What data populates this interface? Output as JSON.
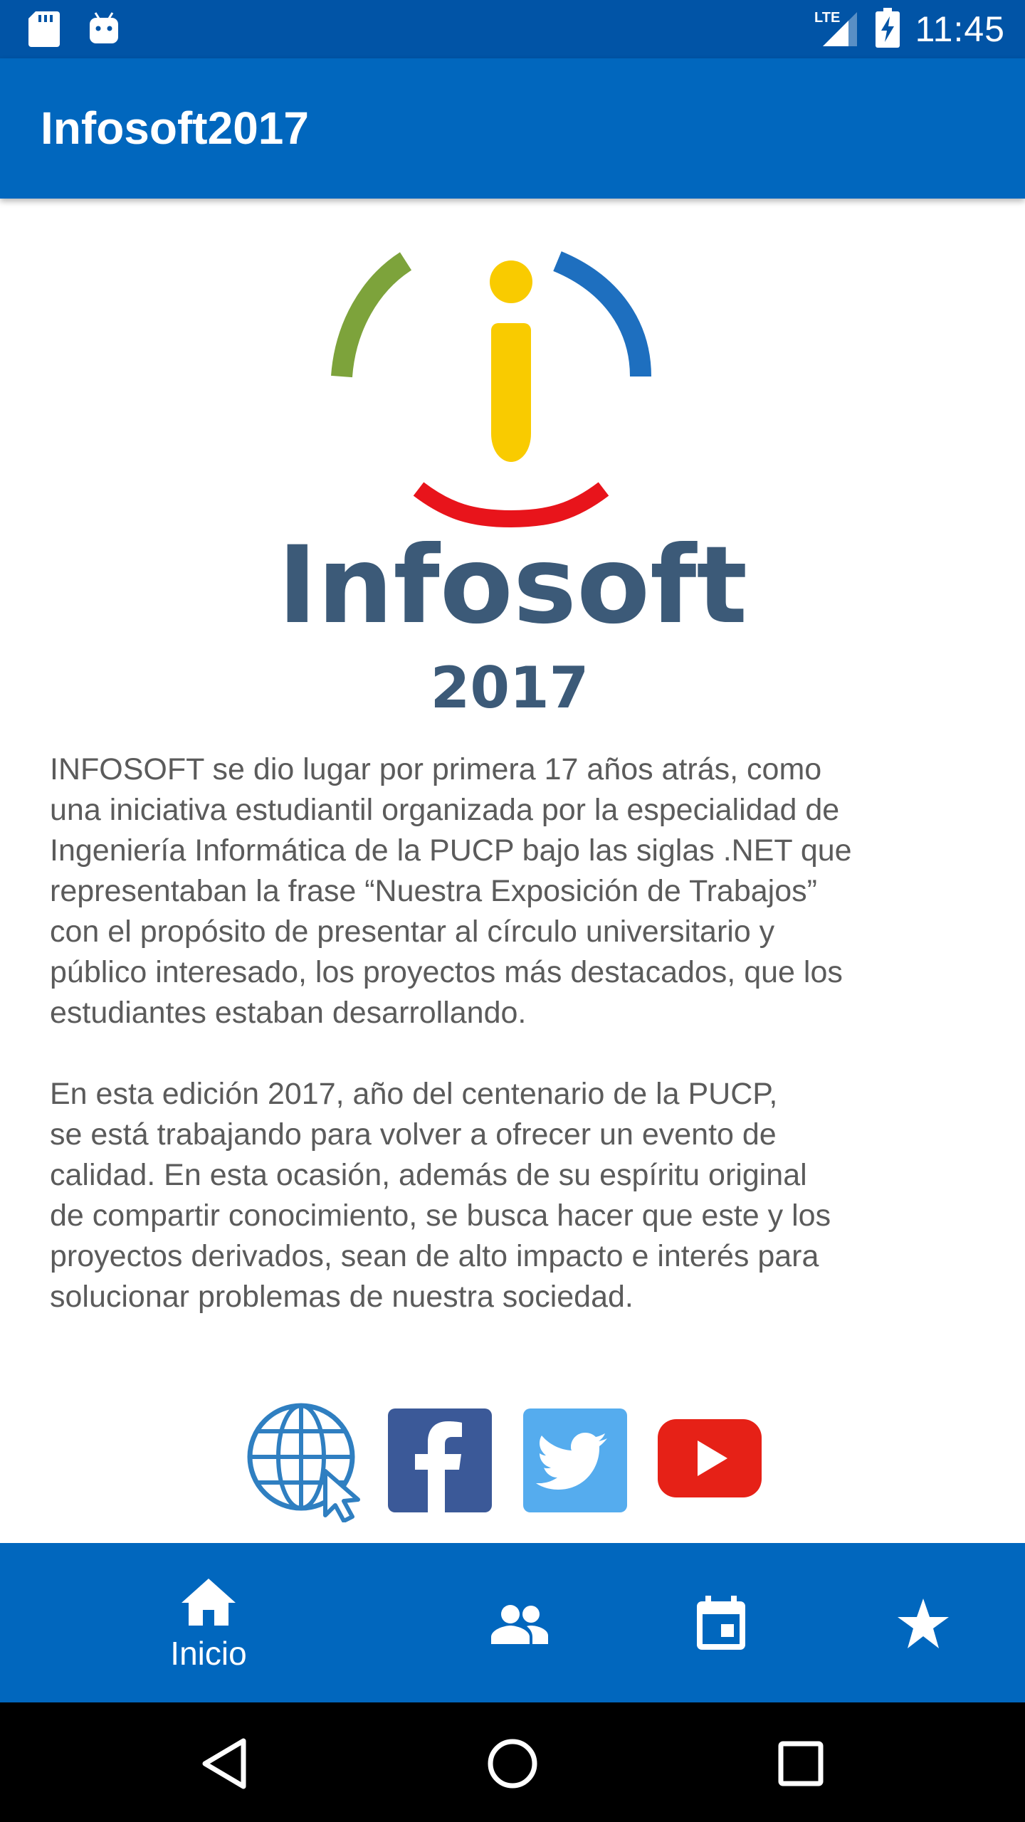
{
  "status_bar": {
    "time": "11:45",
    "network": "LTE",
    "icons": [
      "sd-card-icon",
      "android-icon",
      "lte-signal-icon",
      "battery-charging-icon"
    ]
  },
  "app_bar": {
    "title": "Infosoft2017"
  },
  "logo": {
    "wordmark": "Infosoft",
    "year": "2017",
    "colors": {
      "green": "#7DA33B",
      "blue": "#1E6FBF",
      "yellow": "#F9CB00",
      "red": "#E8141B",
      "text": "#3C5A78"
    }
  },
  "content": {
    "paragraph_1": "INFOSOFT se dio lugar por primera 17 años atrás, como\nuna iniciativa estudiantil organizada por la especialidad de\nIngeniería Informática de la PUCP bajo las siglas .NET que\nrepresentaban la frase “Nuestra Exposición de Trabajos”\ncon el propósito de presentar al círculo universitario y\npúblico interesado, los proyectos más destacados, que los\nestudiantes estaban desarrollando.",
    "paragraph_2": "En esta edición 2017, año del centenario de la PUCP,\nse está trabajando para volver a ofrecer un evento de\ncalidad. En esta ocasión, además de su espíritu original\nde compartir conocimiento, se busca hacer que este y los\nproyectos derivados, sean de alto impacto e interés para\nsolucionar problemas de nuestra sociedad."
  },
  "social_links": [
    {
      "name": "web",
      "icon": "globe-cursor-icon",
      "color": "#2F7FC1"
    },
    {
      "name": "facebook",
      "icon": "facebook-icon",
      "color": "#3B5998"
    },
    {
      "name": "twitter",
      "icon": "twitter-icon",
      "color": "#55ACEE"
    },
    {
      "name": "youtube",
      "icon": "youtube-icon",
      "color": "#E62117"
    }
  ],
  "bottom_nav": {
    "items": [
      {
        "label": "Inicio",
        "icon": "home-icon",
        "selected": true
      },
      {
        "label": "",
        "icon": "people-icon",
        "selected": false
      },
      {
        "label": "",
        "icon": "calendar-icon",
        "selected": false
      },
      {
        "label": "",
        "icon": "star-icon",
        "selected": false
      }
    ]
  },
  "system_nav": [
    "back-icon",
    "home-circle-icon",
    "recents-icon"
  ],
  "colors": {
    "status_bar": "#0154A6",
    "primary": "#0167BE",
    "body_text": "#5B5B5B"
  }
}
